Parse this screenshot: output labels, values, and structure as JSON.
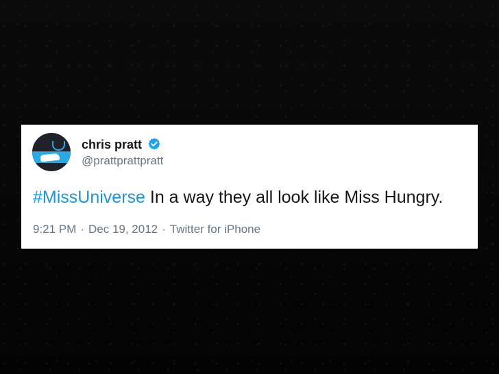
{
  "tweet": {
    "user": {
      "name": "chris pratt",
      "handle": "@prattprattpratt",
      "verified": true,
      "avatar_icon": "avatar"
    },
    "hashtag": "#MissUniverse",
    "text": " In a way they all look like Miss Hungry.",
    "time": "9:21 PM",
    "date": "Dec 19, 2012",
    "source": "Twitter for iPhone",
    "separator": "·"
  },
  "colors": {
    "background": "#050505",
    "card": "#ffffff",
    "hashtag": "#1b95e0",
    "verified": "#1da1f2",
    "meta": "#657786",
    "text": "#14171a"
  }
}
